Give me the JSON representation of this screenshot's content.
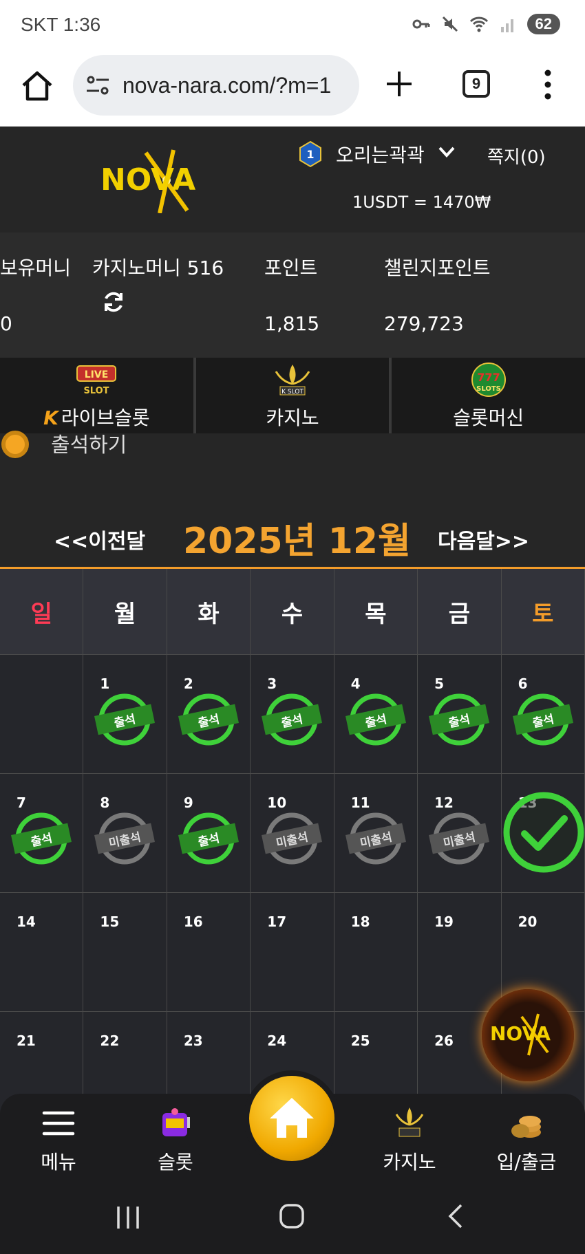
{
  "status_bar": {
    "carrier_time": "SKT 1:36",
    "battery": "62"
  },
  "browser": {
    "url": "nova-nara.com/?m=1",
    "tab_count": "9"
  },
  "header": {
    "logo_text": "NOVA",
    "level": "1",
    "username": "오리는곽곽",
    "messages": "쪽지(0)",
    "rate": "1USDT = 1470₩"
  },
  "balance": {
    "labels": [
      "보유머니",
      "카지노머니 516",
      "포인트",
      "챌린지포인트"
    ],
    "values": [
      "0",
      "",
      "1,815",
      "279,723"
    ]
  },
  "game_tabs": [
    {
      "label": "라이브슬롯",
      "icon": "live-slot-icon"
    },
    {
      "label": "카지노",
      "icon": "k-slot-icon"
    },
    {
      "label": "슬롯머신",
      "icon": "777-slots-icon"
    }
  ],
  "attendance": {
    "label": "출석하기"
  },
  "calendar": {
    "prev": "<<이전달",
    "next": "다음달>>",
    "title": "2025년 12월",
    "weekdays": [
      "일",
      "월",
      "화",
      "수",
      "목",
      "금",
      "토"
    ],
    "stamp_attended": "출석",
    "stamp_missed": "미출석",
    "days": [
      "1",
      "2",
      "3",
      "4",
      "5",
      "6",
      "7",
      "8",
      "9",
      "10",
      "11",
      "12",
      "13",
      "14",
      "15",
      "16",
      "17",
      "18",
      "19",
      "20",
      "21",
      "22",
      "23",
      "24",
      "25",
      "26"
    ]
  },
  "bottom_nav": {
    "menu": "메뉴",
    "slot": "슬롯",
    "casino": "카지노",
    "deposit": "입/출금"
  },
  "colors": {
    "accent": "#f39c2a",
    "sunday": "#ff3b55",
    "attended": "#3fd13a",
    "missed": "#7a7a7a"
  }
}
